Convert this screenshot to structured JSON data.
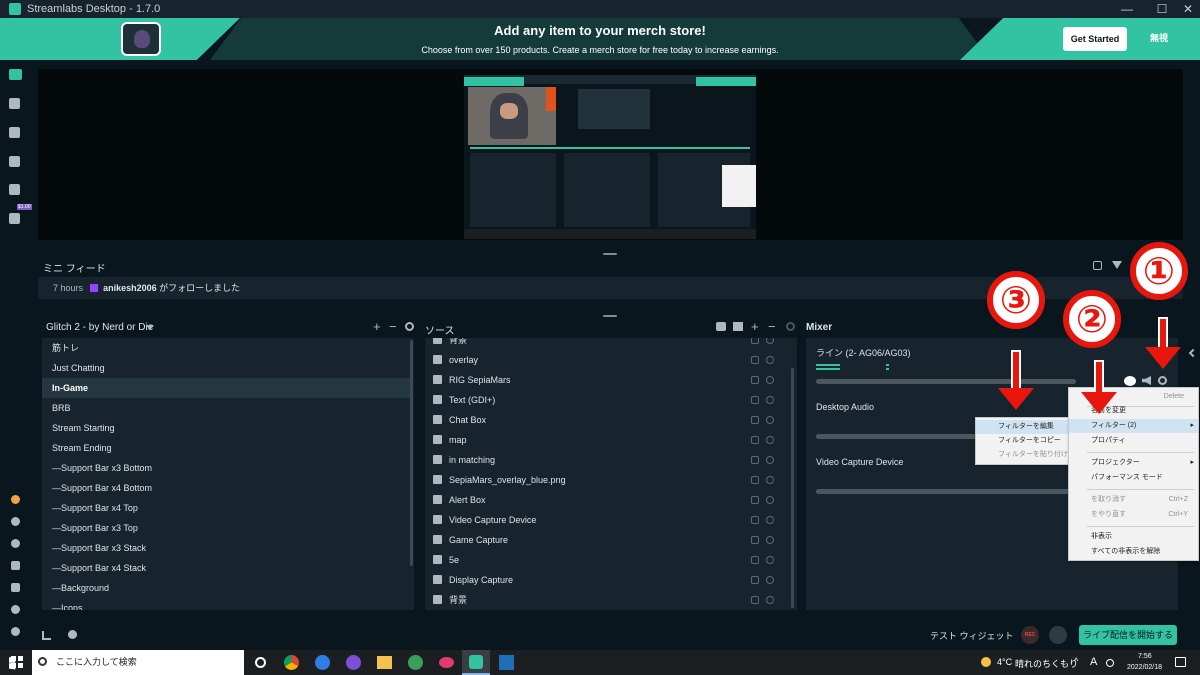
{
  "window": {
    "title": "Streamlabs Desktop - 1.7.0",
    "minimize": "—",
    "maximize": "☐",
    "close": "✕"
  },
  "banner": {
    "headline": "Add any item to your merch store!",
    "subline": "Choose from over 150 products. Create a merch store for free today to increase earnings.",
    "cta": "Get Started",
    "dismiss": "無視"
  },
  "leftnav": {
    "badge": "$1.00"
  },
  "minifeed": {
    "title": "ミニ フィード",
    "time": "7 hours",
    "user": "anikesh2006",
    "action": "がフォローしました"
  },
  "scenes": {
    "collection": "Glitch 2 - by Nerd or Die",
    "items": [
      "筋トレ",
      "Just Chatting",
      "In-Game",
      "BRB",
      "Stream Starting",
      "Stream Ending",
      "—Support Bar x3 Bottom",
      "—Support Bar x4 Bottom",
      "—Support Bar x4 Top",
      "—Support Bar x3 Top",
      "—Support Bar x3 Stack",
      "—Support Bar x4 Stack",
      "—Background",
      "—Icons"
    ],
    "active": "In-Game"
  },
  "sources": {
    "title": "ソース",
    "items": [
      {
        "label": "背景",
        "icon": "image-icon"
      },
      {
        "label": "overlay",
        "icon": "image-icon"
      },
      {
        "label": "RIG SepiaMars",
        "icon": "text-icon"
      },
      {
        "label": "Text (GDI+)",
        "icon": "text-icon"
      },
      {
        "label": "Chat Box",
        "icon": "chat-icon"
      },
      {
        "label": "map",
        "icon": "image-icon"
      },
      {
        "label": "in matching",
        "icon": "image-icon"
      },
      {
        "label": "SepiaMars_overlay_blue.png",
        "icon": "image-icon"
      },
      {
        "label": "Alert Box",
        "icon": "bell-icon"
      },
      {
        "label": "Video Capture Device",
        "icon": "camera-icon"
      },
      {
        "label": "Game Capture",
        "icon": "gamepad-icon"
      },
      {
        "label": "5e",
        "icon": "monitor-icon"
      },
      {
        "label": "Display Capture",
        "icon": "monitor-icon"
      },
      {
        "label": "背景",
        "icon": "image-icon"
      }
    ]
  },
  "mixer": {
    "title": "Mixer",
    "channels": [
      "ライン (2- AG06/AG03)",
      "Desktop Audio",
      "Video Capture Device"
    ]
  },
  "context_menu": {
    "delete": "Delete",
    "rename": "名前を変更",
    "filters": "フィルター (2)",
    "properties": "プロパティ",
    "projector": "プロジェクター",
    "performance": "パフォーマンス モード",
    "undo": "を取り消す",
    "undo_shortcut": "Ctrl+Z",
    "redo": "をやり直す",
    "redo_shortcut": "Ctrl+Y",
    "hide": "非表示",
    "unhide_all": "すべての非表示を解除"
  },
  "filter_submenu": {
    "edit": "フィルターを編集",
    "copy": "フィルターをコピー",
    "paste": "フィルターを貼り付け"
  },
  "annotations": {
    "one": "①",
    "two": "②",
    "three": "③"
  },
  "footer": {
    "test_widget": "テスト ウィジェット",
    "rec": "REC",
    "go_live": "ライブ配信を開始する"
  },
  "taskbar": {
    "search_placeholder": "ここに入力して検索",
    "temp": "4°C",
    "weather": "晴れのちくもり",
    "ime": "A",
    "time": "7:56",
    "date": "2022/02/18"
  },
  "colors": {
    "accent": "#31c3a2",
    "panel": "#17242d",
    "bg": "#09161d",
    "annotation": "#e8160c"
  }
}
